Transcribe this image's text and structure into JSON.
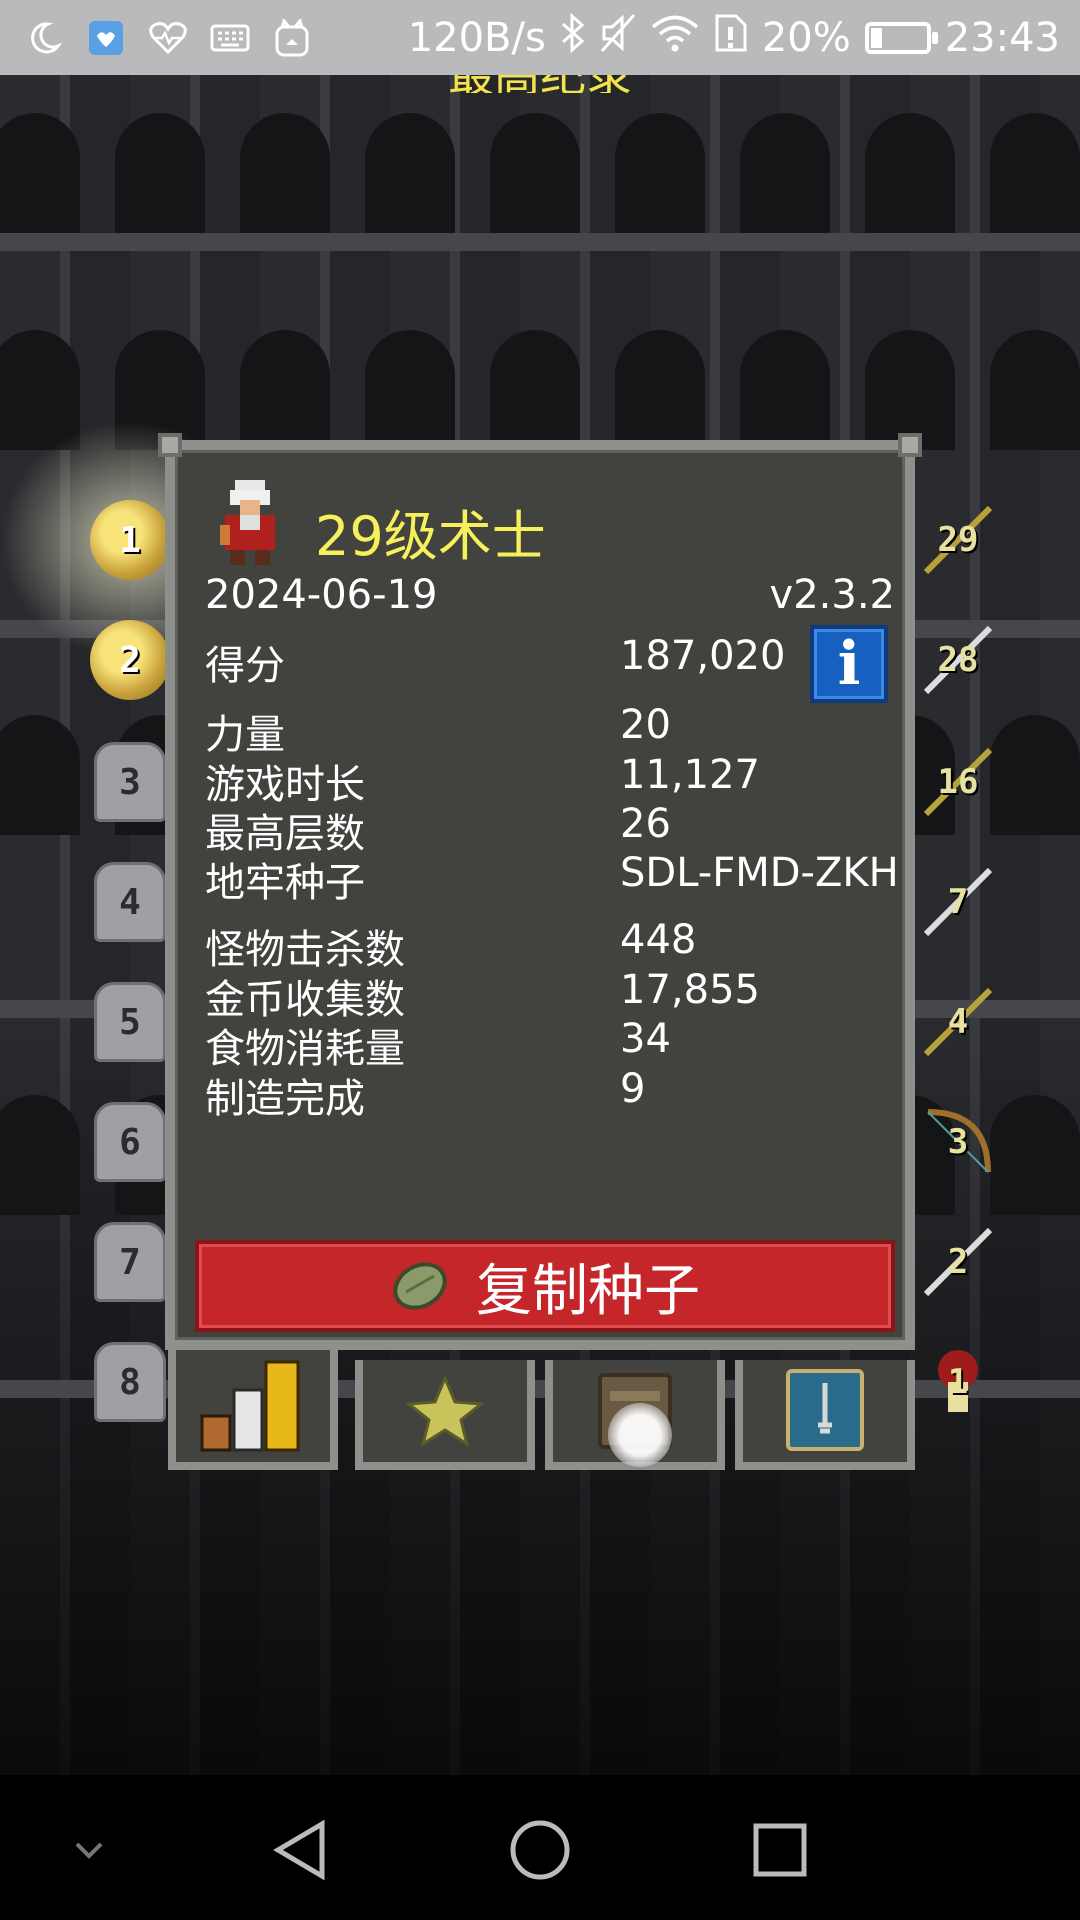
{
  "status_bar": {
    "speed": "120B/s",
    "battery_percent": "20%",
    "battery_level": 0.2,
    "time": "23:43",
    "left_icons": [
      "moon-icon",
      "health-app-icon",
      "heartrate-icon",
      "keyboard-icon",
      "cat-app-icon"
    ],
    "right_icons": [
      "bluetooth-icon",
      "mute-icon",
      "wifi-icon",
      "sim-icon"
    ]
  },
  "screen": {
    "title": "最高纪录"
  },
  "rankings": {
    "ranks": [
      "1",
      "2",
      "3",
      "4",
      "5",
      "6",
      "7",
      "8"
    ],
    "levels": [
      "29",
      "28",
      "16",
      "7",
      "4",
      "3",
      "2",
      "1"
    ]
  },
  "record": {
    "title": "29级术士",
    "date": "2024-06-19",
    "version": "v2.3.2",
    "score_label": "得分",
    "score_value": "187,020",
    "stats": [
      {
        "label": "力量",
        "value": "20"
      },
      {
        "label": "游戏时长",
        "value": "11,127"
      },
      {
        "label": "最高层数",
        "value": "26"
      },
      {
        "label": "地牢种子",
        "value": "SDL-FMD-ZKH"
      }
    ],
    "stats2": [
      {
        "label": "怪物击杀数",
        "value": "448"
      },
      {
        "label": "金币收集数",
        "value": "17,855"
      },
      {
        "label": "食物消耗量",
        "value": "34"
      },
      {
        "label": "制造完成",
        "value": "9"
      }
    ],
    "copy_seed_label": "复制种子",
    "info_icon_text": "i"
  },
  "colors": {
    "title_yellow": "#f6f05a",
    "button_red": "#c4262a",
    "info_blue": "#1760c0",
    "panel_bg": "#42433f"
  }
}
